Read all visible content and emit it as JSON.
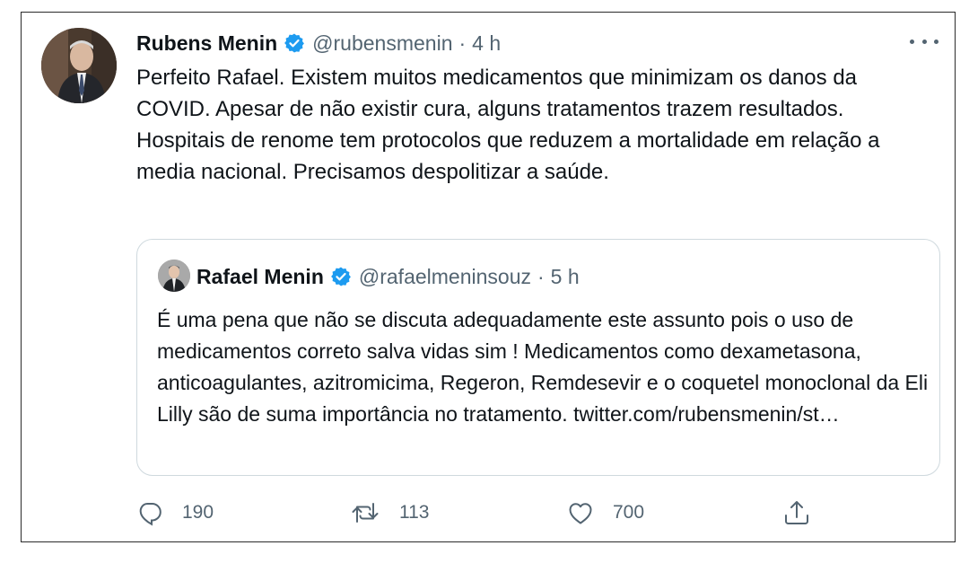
{
  "tweet": {
    "author_name": "Rubens Menin",
    "author_handle": "@rubensmenin",
    "separator": "·",
    "time": "4 h",
    "text": "Perfeito Rafael. Existem muitos medicamentos que minimizam os danos da COVID. Apesar de não existir cura, alguns tratamentos trazem resultados. Hospitais de renome tem protocolos que reduzem a mortalidade em relação a media nacional. Precisamos despolitizar a saúde."
  },
  "quoted_tweet": {
    "author_name": "Rafael Menin",
    "author_handle": "@rafaelmeninsouz",
    "separator": "·",
    "time": "5 h",
    "text": "É uma pena que não se discuta adequadamente este assunto pois o uso de medicamentos correto salva vidas sim ! Medicamentos como dexametasona, anticoagulantes, azitromicima, Regeron, Remdesevir e o coquetel monoclonal da Eli Lilly são de suma importância no tratamento. twitter.com/rubensmenin/st…"
  },
  "actions": {
    "reply_count": "190",
    "retweet_count": "113",
    "like_count": "700"
  },
  "icons": {
    "verified": "verified-badge-icon",
    "more": "more-options-icon",
    "reply": "reply-icon",
    "retweet": "retweet-icon",
    "like": "heart-icon",
    "share": "share-icon"
  },
  "colors": {
    "text": "#0f1419",
    "secondary": "#536471",
    "verified": "#1d9bf0",
    "border": "#cfd9de"
  }
}
